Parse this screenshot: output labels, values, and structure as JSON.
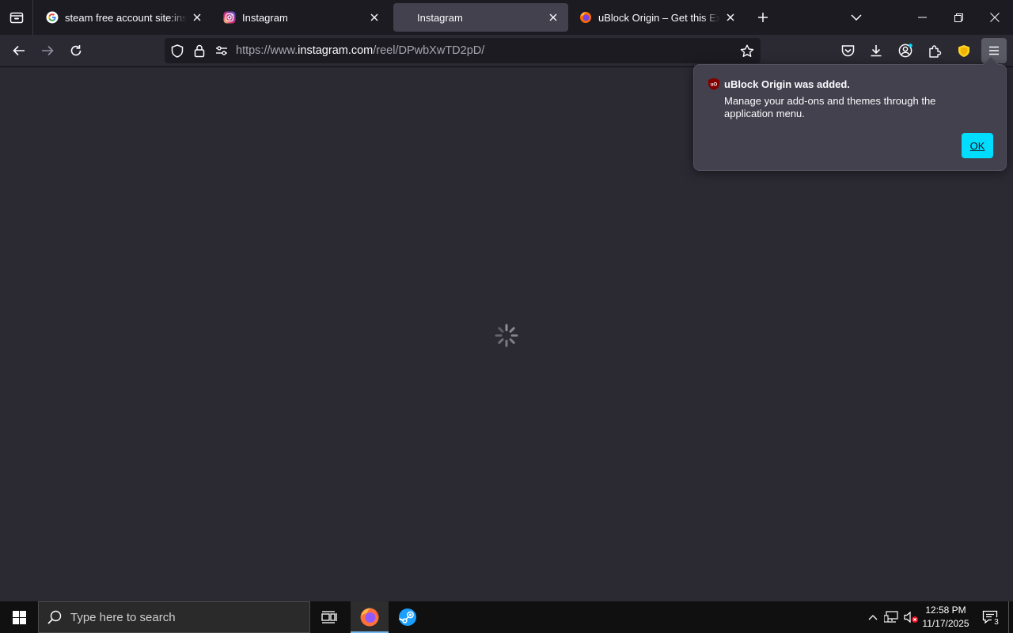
{
  "tabs": [
    {
      "label": "steam free account site:instagram.com",
      "favicon": "google-g-icon",
      "selected": false
    },
    {
      "label": "Instagram",
      "favicon": "instagram-icon",
      "selected": false
    },
    {
      "label": "Instagram",
      "favicon": "none",
      "selected": true
    },
    {
      "label": "uBlock Origin – Get this Extension for Firefox",
      "favicon": "firefox-icon",
      "selected": false
    }
  ],
  "urlbar": {
    "prefix": "https://www.",
    "host": "instagram.com",
    "path": "/reel/DPwbXwTD2pD/"
  },
  "addon_panel": {
    "title": "uBlock Origin was added.",
    "message": "Manage your add-ons and themes through the application menu.",
    "ok_label": "OK"
  },
  "taskbar": {
    "search_placeholder": "Type here to search",
    "time": "12:58 PM",
    "date": "11/17/2025",
    "notification_count": "3"
  },
  "colors": {
    "accent": "#00ddff",
    "tabstrip": "#1c1b22",
    "toolbar": "#2b2a33",
    "panel": "#42414d"
  }
}
